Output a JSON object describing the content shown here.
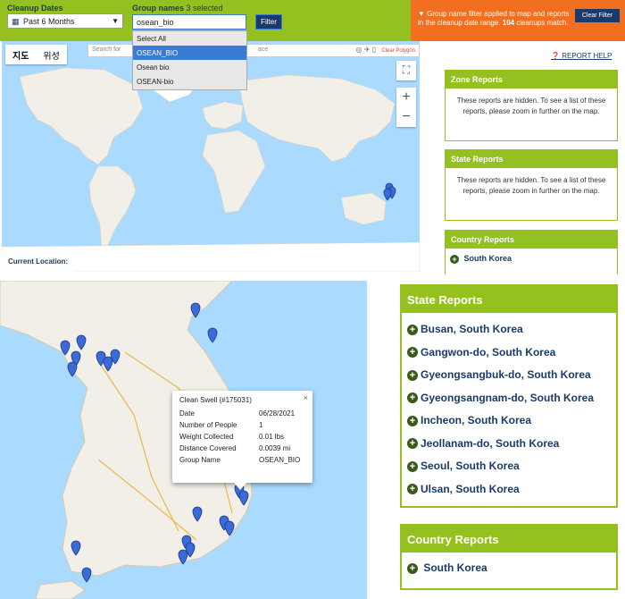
{
  "filter_bar": {
    "cleanup_dates_label": "Cleanup Dates",
    "date_value": "Past 6 Months",
    "group_names_label": "Group names",
    "selected_count": "3 selected",
    "group_input_value": "osean_bio",
    "filter_button": "Filter",
    "dropdown_options": [
      "Select All",
      "OSEAN_BIO",
      "Osean bio",
      "OSEAN-bio"
    ],
    "dropdown_selected": "OSEAN_BIO"
  },
  "notice": {
    "text_prefix": "Group name filter applied to map and reports in the cleanup date range.",
    "match_count": "104",
    "text_suffix": "cleanups match.",
    "clear_button": "Clear Filter"
  },
  "world_map": {
    "map_type_map": "지도",
    "map_type_satellite": "위성",
    "search_placeholder": "Search for",
    "address_placeholder": "ace",
    "clear_polygon": "Clear Polygon",
    "current_location_label": "Current Location:",
    "zoom_in": "+",
    "zoom_out": "−"
  },
  "report_help": "REPORT HELP",
  "zone_reports": {
    "title": "Zone Reports",
    "text": "These reports are hidden. To see a list of these reports, please zoom in further on the map."
  },
  "state_reports_small": {
    "title": "State Reports",
    "text": "These reports are hidden. To see a list of these reports, please zoom in further on the map."
  },
  "country_reports_small": {
    "title": "Country Reports",
    "item": "South Korea"
  },
  "popup": {
    "title": "Clean Swell (#175031)",
    "close": "×",
    "rows": [
      {
        "label": "Date",
        "value": "06/28/2021"
      },
      {
        "label": "Number of People",
        "value": "1"
      },
      {
        "label": "Weight Collected",
        "value": "0.01 lbs"
      },
      {
        "label": "Distance Covered",
        "value": "0.0039 mi"
      },
      {
        "label": "Group Name",
        "value": "OSEAN_BIO"
      }
    ]
  },
  "state_reports": {
    "title": "State Reports",
    "items": [
      "Busan, South Korea",
      "Gangwon-do, South Korea",
      "Gyeongsangbuk-do, South Korea",
      "Gyeongsangnam-do, South Korea",
      "Incheon, South Korea",
      "Jeollanam-do, South Korea",
      "Seoul, South Korea",
      "Ulsan, South Korea"
    ]
  },
  "country_reports": {
    "title": "Country Reports",
    "item": "South Korea"
  },
  "colors": {
    "brand_green": "#94c11f",
    "notice_orange": "#f26f1f",
    "navy": "#1a3a6a",
    "water": "#aadaff",
    "marker": "#3b6bd6"
  }
}
